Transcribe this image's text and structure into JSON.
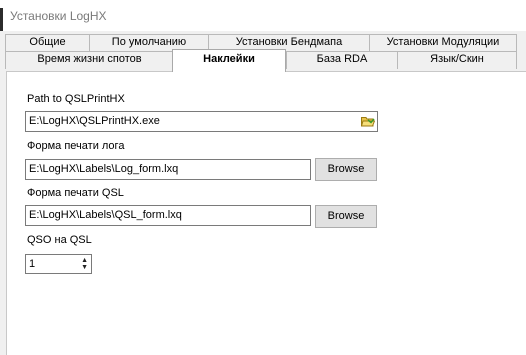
{
  "window": {
    "title": "Установки LogHX"
  },
  "tabs": {
    "row1": [
      "Общие",
      "По умолчанию",
      "Установки Бендмапа",
      "Установки Модуляции"
    ],
    "row2": [
      "Время жизни спотов",
      "Наклейки",
      "База RDA",
      "Язык/Скин"
    ],
    "active": "Наклейки"
  },
  "labels_tab": {
    "qslprint": {
      "label": "Path to QSLPrintHX",
      "value": "E:\\LogHX\\QSLPrintHX.exe",
      "browse_icon": "folder-open-icon"
    },
    "log_form": {
      "label": "Форма печати лога",
      "value": "E:\\LogHX\\Labels\\Log_form.lxq",
      "button": "Browse"
    },
    "qsl_form": {
      "label": "Форма печати QSL",
      "value": "E:\\LogHX\\Labels\\QSL_form.lxq",
      "button": "Browse"
    },
    "qso_per_qsl": {
      "label": "QSO на QSL",
      "value": "1"
    }
  }
}
